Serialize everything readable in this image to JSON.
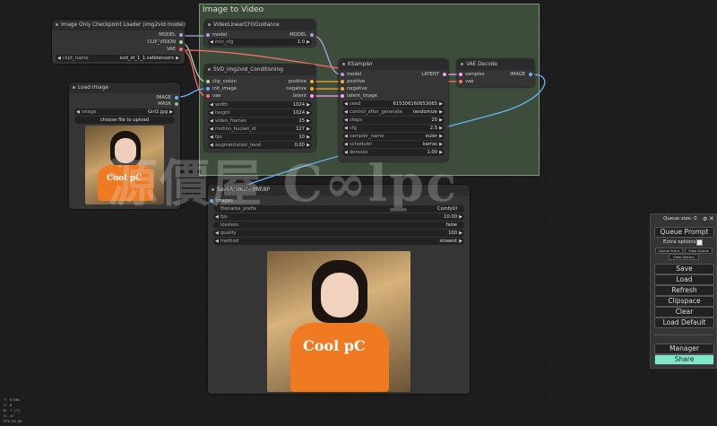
{
  "group": {
    "title": "Image to Video"
  },
  "ckpt": {
    "title": "Image Only Checkpoint Loader (img2vid model)",
    "outputs": [
      "MODEL",
      "CLIP_VISION",
      "VAE"
    ],
    "widget": {
      "label": "ckpt_name",
      "value": "svd_xt_1_1.safetensors"
    }
  },
  "load_image": {
    "title": "Load Image",
    "outputs": [
      "IMAGE",
      "MASK"
    ],
    "widget": {
      "label": "image",
      "value": "Girl2.jpg"
    },
    "upload": "choose file to upload",
    "photo_text": "Cool pC"
  },
  "guidance": {
    "title": "VideoLinearCFGGuidance",
    "input": "model",
    "output": "MODEL",
    "widget": {
      "label": "min_cfg",
      "value": "1.0"
    }
  },
  "svd": {
    "title": "SVD_img2vid_Conditioning",
    "inputs": [
      "clip_vision",
      "init_image",
      "vae"
    ],
    "outputs": [
      "positive",
      "negative",
      "latent"
    ],
    "widgets": [
      {
        "label": "width",
        "value": "1024"
      },
      {
        "label": "height",
        "value": "1024"
      },
      {
        "label": "video_frames",
        "value": "25"
      },
      {
        "label": "motion_bucket_id",
        "value": "127"
      },
      {
        "label": "fps",
        "value": "10"
      },
      {
        "label": "augmentation_level",
        "value": "0.00"
      }
    ]
  },
  "ksampler": {
    "title": "KSampler",
    "inputs": [
      "model",
      "positive",
      "negative",
      "latent_image"
    ],
    "output": "LATENT",
    "widgets": [
      {
        "label": "seed",
        "value": "615306160653065"
      },
      {
        "label": "control_after_generate",
        "value": "randomize"
      },
      {
        "label": "steps",
        "value": "20"
      },
      {
        "label": "cfg",
        "value": "2.5"
      },
      {
        "label": "sampler_name",
        "value": "euler"
      },
      {
        "label": "scheduler",
        "value": "karras"
      },
      {
        "label": "denoise",
        "value": "1.00"
      }
    ]
  },
  "vae_decode": {
    "title": "VAE Decode",
    "inputs": [
      "samples",
      "vae"
    ],
    "output": "IMAGE"
  },
  "save": {
    "title": "SaveAnimatedWEBP",
    "input": "images",
    "widgets": [
      {
        "label": "filename_prefix",
        "value": "ComfyUI"
      },
      {
        "label": "fps",
        "value": "10.00"
      },
      {
        "label": "lossless",
        "value": "false"
      },
      {
        "label": "quality",
        "value": "100"
      },
      {
        "label": "method",
        "value": "slowest"
      }
    ],
    "photo_text": "Cool pC"
  },
  "watermark": "源價屋 C∞lpc",
  "queue_panel": {
    "title": "Queue size: 0",
    "queue_prompt": "Queue Prompt",
    "extra_options": "Extra options",
    "small": [
      "Queue Front",
      "View Queue",
      "View History"
    ],
    "buttons": [
      "Save",
      "Load",
      "Refresh",
      "Clipspace",
      "Clear",
      "Load Default"
    ],
    "manager": "Manager",
    "share": "Share"
  },
  "corner_stats": [
    "T: 0.00s",
    "I: 0",
    "N: 7 [7]",
    "V: 17",
    "FPS:59.86"
  ],
  "colors": {
    "model": "#b39ddb",
    "clip_vision": "#a5d6a7",
    "vae": "#ff6e6e",
    "image": "#64b5f6",
    "conditioning": "#ffa931",
    "latent": "#ff9cf9",
    "share": "#7ee8c8",
    "group_bg": "#5a7355"
  }
}
